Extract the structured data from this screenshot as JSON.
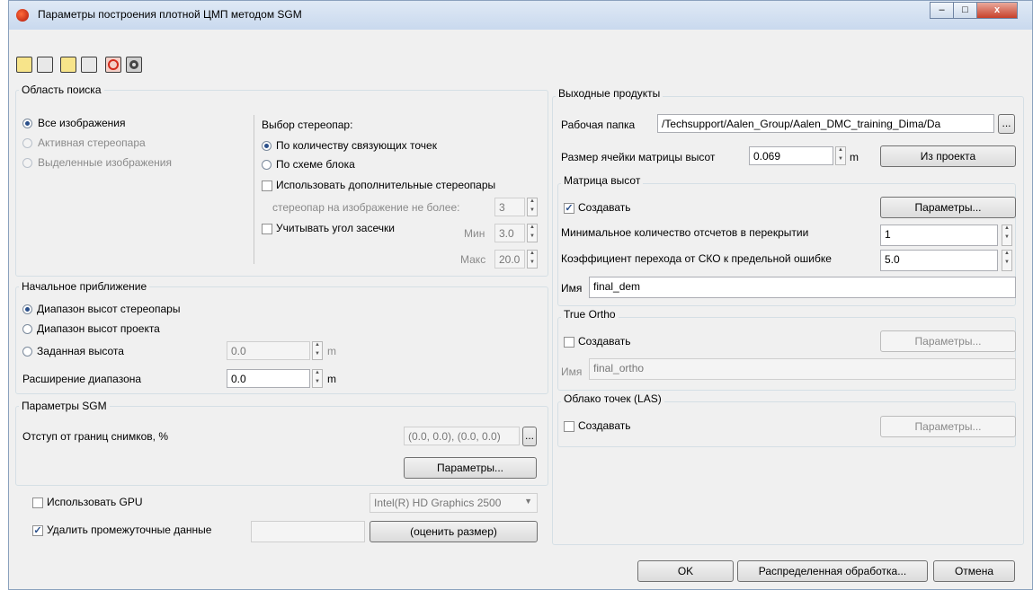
{
  "window": {
    "title": "Параметры построения плотной ЦМП методом SGM",
    "minimize": "–",
    "maximize": "□",
    "close": "x"
  },
  "toolbar": [
    "open-icon",
    "save-as-icon",
    "open-folder-icon",
    "save-icon",
    "refresh-icon",
    "settings-icon"
  ],
  "search_area": {
    "title": "Область поиска",
    "all_images": "Все изображения",
    "active_pair": "Активная стереопара",
    "selected_images": "Выделенные изображения",
    "pair_select_title": "Выбор стереопар:",
    "by_tie_points": "По количеству связующих точек",
    "by_block_scheme": "По схеме блока",
    "use_extra_pairs": "Использовать дополнительные стереопары",
    "pairs_per_image": "стереопар на изображение не более:",
    "pairs_per_image_value": "3",
    "consider_angle": "Учитывать угол засечки",
    "min_label": "Мин",
    "min_value": "3.0",
    "max_label": "Макс",
    "max_value": "20.0"
  },
  "initial_approx": {
    "title": "Начальное приближение",
    "pair_range": "Диапазон высот стереопары",
    "project_range": "Диапазон высот проекта",
    "fixed_height": "Заданная высота",
    "fixed_height_value": "0.0",
    "fixed_height_unit": "m",
    "range_expansion": "Расширение диапазона",
    "range_expansion_value": "0.0",
    "range_expansion_unit": "m"
  },
  "sgm": {
    "title": "Параметры SGM",
    "offset_label": "Отступ от границ снимков, %",
    "offset_value": "(0.0, 0.0), (0.0, 0.0)",
    "dots": "...",
    "params_button": "Параметры..."
  },
  "gpu": {
    "use_gpu": "Использовать GPU",
    "gpu_name": "Intel(R) HD Graphics 2500",
    "delete_temp": "Удалить промежуточные данные",
    "estimate_button": "(оценить размер)"
  },
  "output": {
    "title": "Выходные продукты",
    "work_folder_label": "Рабочая папка",
    "work_folder_value": "/Techsupport/Aalen_Group/Aalen_DMC_training_Dima/Da",
    "dots": "...",
    "cell_size_label": "Размер ячейки матрицы высот",
    "cell_size_value": "0.069",
    "cell_size_unit": "m",
    "from_project_button": "Из проекта"
  },
  "dem": {
    "title": "Матрица высот",
    "create": "Создавать",
    "params_button": "Параметры...",
    "min_count_label": "Минимальное количество отсчетов в перекрытии",
    "min_count_value": "1",
    "coef_label": "Коэффициент перехода от СКО к предельной ошибке",
    "coef_value": "5.0",
    "name_label": "Имя",
    "name_value": "final_dem"
  },
  "true_ortho": {
    "title": "True Ortho",
    "create": "Создавать",
    "params_button": "Параметры...",
    "name_label": "Имя",
    "name_value": "final_ortho"
  },
  "las": {
    "title": "Облако точек (LAS)",
    "create": "Создавать",
    "params_button": "Параметры..."
  },
  "footer": {
    "ok": "OK",
    "distributed": "Распределенная обработка...",
    "cancel": "Отмена"
  }
}
